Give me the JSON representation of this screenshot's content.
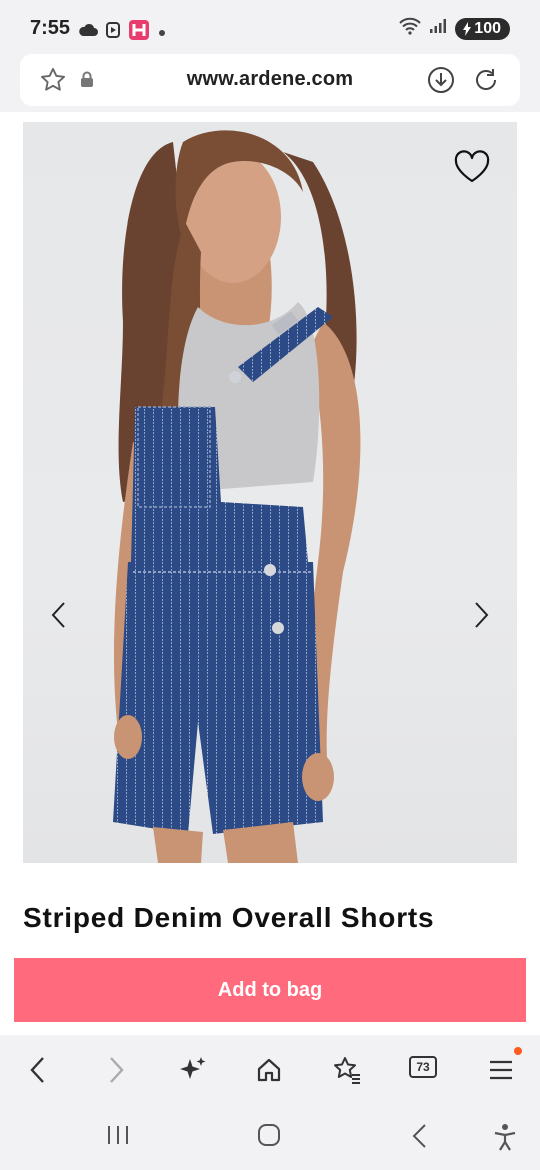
{
  "status_bar": {
    "time": "7:55",
    "battery": "100",
    "icons": [
      "cloud-icon",
      "media-icon",
      "app-notification-icon",
      "dot-icon",
      "wifi-icon",
      "signal-icon",
      "battery-icon"
    ]
  },
  "browser": {
    "url": "www.ardene.com",
    "icons": [
      "favorite-star-icon",
      "lock-icon",
      "download-icon",
      "reload-icon"
    ]
  },
  "product": {
    "title": "Striped Denim Overall Shorts",
    "add_to_bag_label": "Add to bag",
    "image_description_icons": [
      "prev-image-icon",
      "next-image-icon",
      "wishlist-heart-icon"
    ]
  },
  "toolbar": {
    "tab_count": "73",
    "icons": [
      "back-icon",
      "forward-icon",
      "sparkle-icon",
      "home-icon",
      "bookmarks-icon",
      "tabs-icon",
      "menu-icon"
    ]
  },
  "system_nav": {
    "icons": [
      "recents-icon",
      "home-circle-icon",
      "system-back-icon",
      "accessibility-icon"
    ]
  },
  "colors": {
    "accent": "#ff6b7d",
    "bar_bg": "#f2f2f4",
    "denim": "#2c4a86",
    "notification_dot": "#ff5a1f"
  }
}
